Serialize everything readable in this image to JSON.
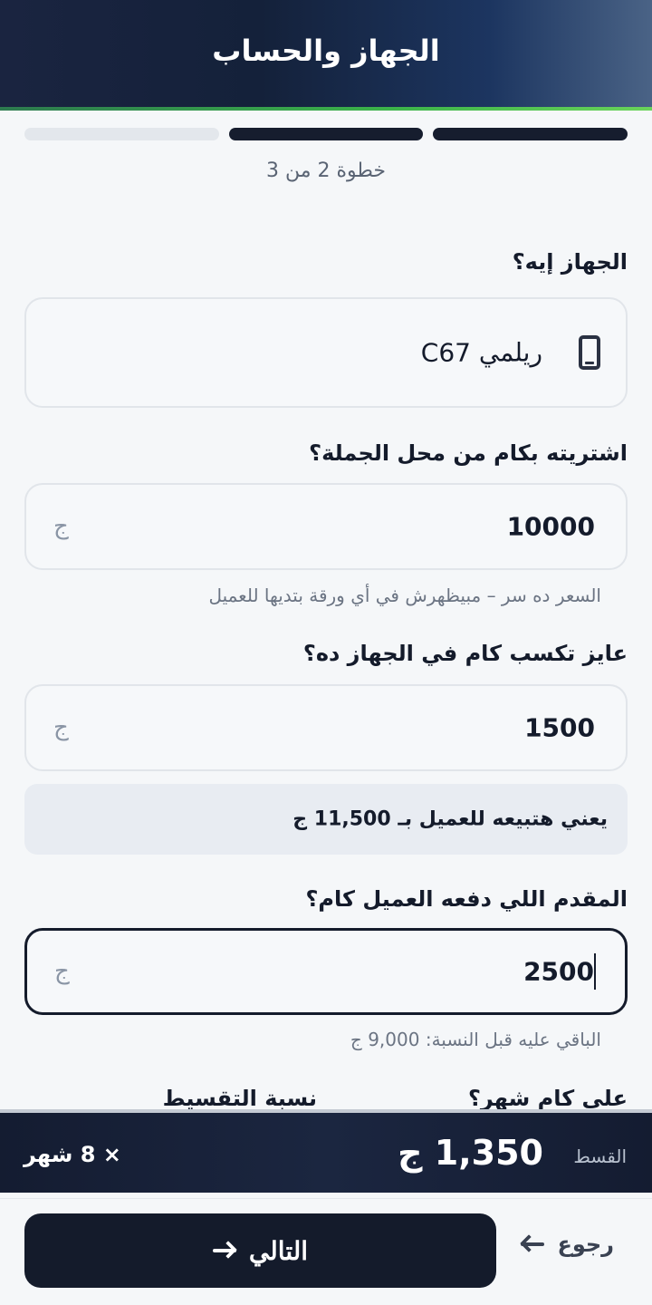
{
  "header": {
    "title": "الجهاز والحساب"
  },
  "progress": {
    "current": 2,
    "total": 3,
    "step_text": "خطوة 2 من 3"
  },
  "device": {
    "label": "الجهاز إيه؟",
    "value": "ريلمي C67",
    "icon": "smartphone-icon"
  },
  "wholesale": {
    "label": "اشتريته بكام من محل الجملة؟",
    "value": "10000",
    "currency": "ج",
    "hint": "السعر ده سر – مبيظهرش في أي ورقة بتديها للعميل"
  },
  "profit": {
    "label": "عايز تكسب كام في الجهاز ده؟",
    "value": "1500",
    "currency": "ج",
    "summary": "يعني هتبيعه للعميل بـ 11,500 ج"
  },
  "down_payment": {
    "label": "المقدم اللي دفعه العميل كام؟",
    "value": "2500",
    "currency": "ج",
    "hint": "الباقي عليه قبل النسبة: 9,000 ج"
  },
  "months_label": "على كام شهر؟",
  "rate_label": "نسبة التقسيط",
  "installment": {
    "label": "القسط",
    "amount": "1,350 ج",
    "months": "× 8 شهر"
  },
  "actions": {
    "next_label": "التالي",
    "back_label": "رجوع"
  },
  "colors": {
    "primary": "#141b2b",
    "accent_green": "#3cb44a",
    "background": "#f5f7f9"
  }
}
